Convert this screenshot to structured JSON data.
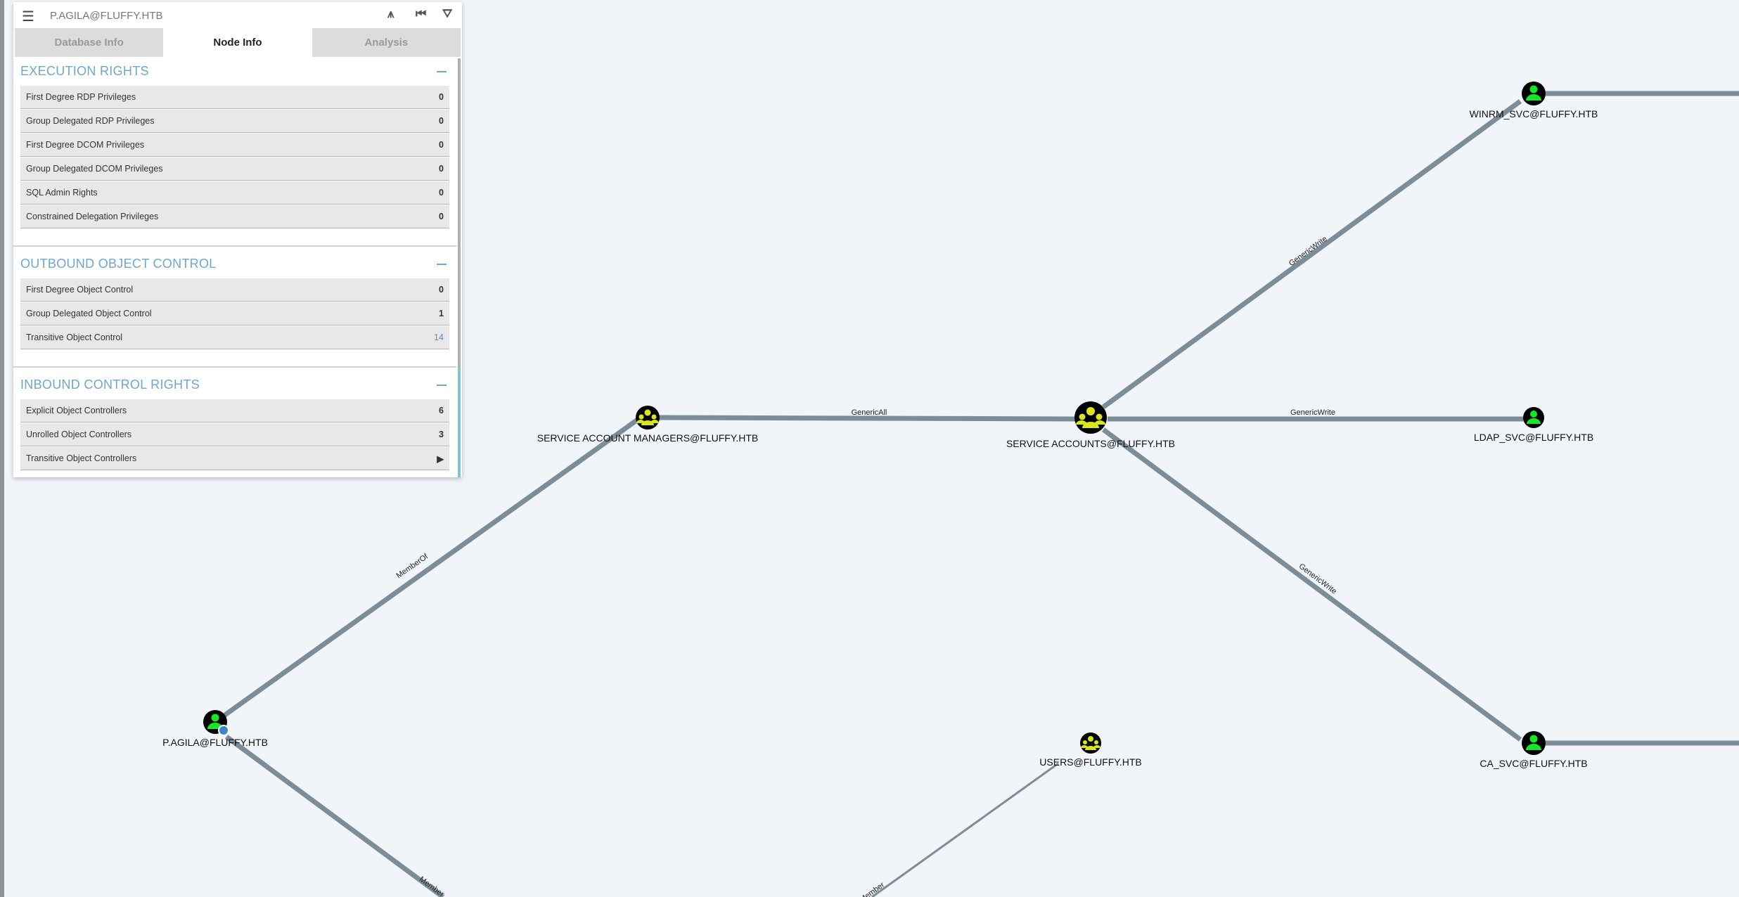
{
  "search": {
    "value": "P.AGILA@FLUFFY.HTB"
  },
  "toolbar_icons": [
    "menu-icon",
    "pathfinding-icon",
    "back-icon",
    "filter-icon"
  ],
  "tabs": [
    {
      "label": "Database Info",
      "active": false
    },
    {
      "label": "Node Info",
      "active": true
    },
    {
      "label": "Analysis",
      "active": false
    }
  ],
  "sections": {
    "execution": {
      "title": "EXECUTION RIGHTS",
      "rows": [
        {
          "label": "First Degree RDP Privileges",
          "value": "0"
        },
        {
          "label": "Group Delegated RDP Privileges",
          "value": "0"
        },
        {
          "label": "First Degree DCOM Privileges",
          "value": "0"
        },
        {
          "label": "Group Delegated DCOM Privileges",
          "value": "0"
        },
        {
          "label": "SQL Admin Rights",
          "value": "0"
        },
        {
          "label": "Constrained Delegation Privileges",
          "value": "0"
        }
      ]
    },
    "outbound": {
      "title": "OUTBOUND OBJECT CONTROL",
      "rows": [
        {
          "label": "First Degree Object Control",
          "value": "0"
        },
        {
          "label": "Group Delegated Object Control",
          "value": "1"
        },
        {
          "label": "Transitive Object Control",
          "value": "14"
        }
      ]
    },
    "inbound": {
      "title": "INBOUND CONTROL RIGHTS",
      "rows": [
        {
          "label": "Explicit Object Controllers",
          "value": "6"
        },
        {
          "label": "Unrolled Object Controllers",
          "value": "3"
        },
        {
          "label": "Transitive Object Controllers",
          "value": "▶"
        }
      ]
    }
  },
  "colors": {
    "user_node": "#17e625",
    "group_node": "#dbe617",
    "edge": "#7b8d98",
    "section_title": "#6ea6cd",
    "background": "#f1f4f9"
  },
  "graph": {
    "nodes": {
      "p_agila": {
        "label": "P.AGILA@FLUFFY.HTB",
        "type": "user",
        "owned": true
      },
      "sam": {
        "label": "SERVICE ACCOUNT MANAGERS@FLUFFY.HTB",
        "type": "group"
      },
      "sa": {
        "label": "SERVICE ACCOUNTS@FLUFFY.HTB",
        "type": "group"
      },
      "winrm": {
        "label": "WINRM_SVC@FLUFFY.HTB",
        "type": "user"
      },
      "ldap": {
        "label": "LDAP_SVC@FLUFFY.HTB",
        "type": "user"
      },
      "ca": {
        "label": "CA_SVC@FLUFFY.HTB",
        "type": "user"
      },
      "users": {
        "label": "USERS@FLUFFY.HTB",
        "type": "group"
      }
    },
    "edges": {
      "memberof_sam": "MemberOf",
      "genericall": "GenericAll",
      "gw_winrm": "GenericWrite",
      "gw_ldap": "GenericWrite",
      "gw_ca": "GenericWrite",
      "memberof_down": "Member",
      "users_edge": "Member"
    }
  }
}
